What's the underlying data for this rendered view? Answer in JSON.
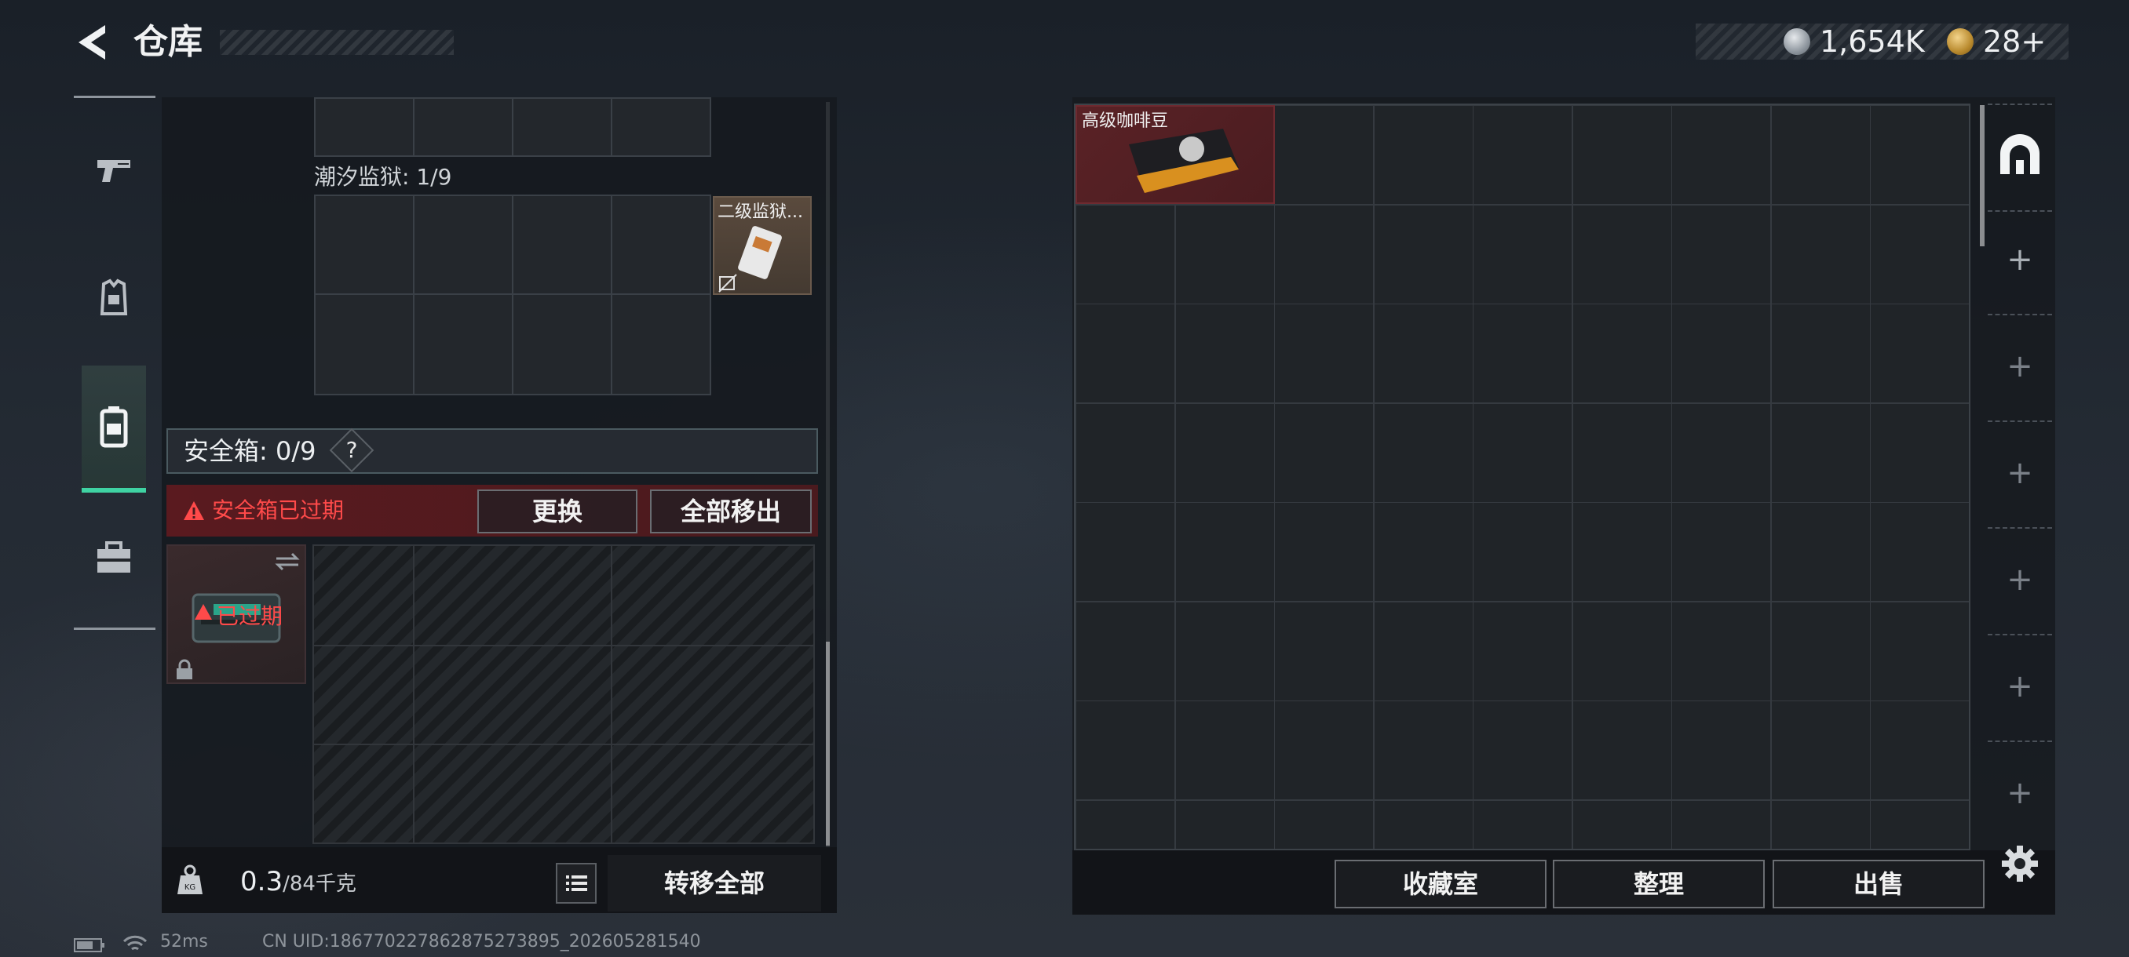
{
  "header": {
    "title": "仓库",
    "currencies": [
      {
        "icon": "silver-coin-icon",
        "value": "1,654K"
      },
      {
        "icon": "gold-coin-icon",
        "value": "28+"
      }
    ]
  },
  "rail": {
    "items": [
      {
        "name": "weapons",
        "icon": "pistol-icon"
      },
      {
        "name": "equipment",
        "icon": "armor-vest-icon"
      },
      {
        "name": "backpack",
        "icon": "backpack-icon",
        "active": true
      },
      {
        "name": "storage",
        "icon": "toolbox-icon"
      }
    ]
  },
  "left_panel": {
    "container_label": "潮汐监狱: 1/9",
    "key_item_name": "二级监狱...",
    "safebox": {
      "label": "安全箱: 0/9",
      "help": "?",
      "expired_notice": "安全箱已过期",
      "replace_button": "更换",
      "move_all_button": "全部移出",
      "expired_tag": "已过期"
    },
    "footer": {
      "weight_value": "0.3",
      "weight_unit": "/84千克",
      "transfer_all": "转移全部"
    }
  },
  "stash": {
    "item_name": "高级咖啡豆",
    "buttons": {
      "collection": "收藏室",
      "sort": "整理",
      "sell": "出售"
    },
    "pages": [
      "+",
      "+",
      "+",
      "+",
      "+",
      "+"
    ]
  },
  "status": {
    "ping": "52ms",
    "uid": "CN UID:18677022786287527389​5_202605281540"
  },
  "colors": {
    "accent_green": "#3fd3a3",
    "warning_red": "#ff4a4a",
    "expired_bg": "#5a1a1f",
    "item_bg_red": "#5a2226"
  }
}
